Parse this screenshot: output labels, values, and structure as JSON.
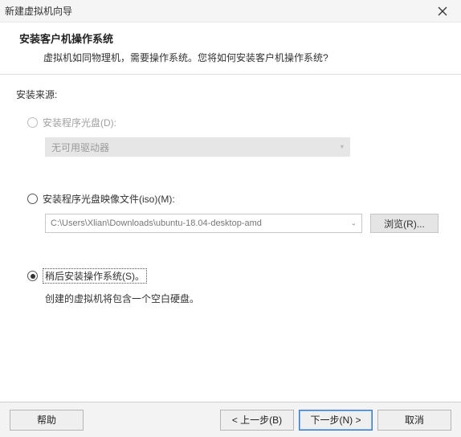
{
  "window": {
    "title": "新建虚拟机向导"
  },
  "header": {
    "heading": "安装客户机操作系统",
    "subheading": "虚拟机如同物理机，需要操作系统。您将如何安装客户机操作系统?"
  },
  "content": {
    "source_label": "安装来源:",
    "option1": {
      "label": "安装程序光盘(D):",
      "dropdown_text": "无可用驱动器"
    },
    "option2": {
      "label": "安装程序光盘映像文件(iso)(M):",
      "path_value": "C:\\Users\\Xlian\\Downloads\\ubuntu-18.04-desktop-amd",
      "browse_label": "浏览(R)..."
    },
    "option3": {
      "label": "稍后安装操作系统(S)。",
      "note": "创建的虚拟机将包含一个空白硬盘。"
    }
  },
  "footer": {
    "help": "帮助",
    "back": "< 上一步(B)",
    "next": "下一步(N) >",
    "cancel": "取消"
  }
}
